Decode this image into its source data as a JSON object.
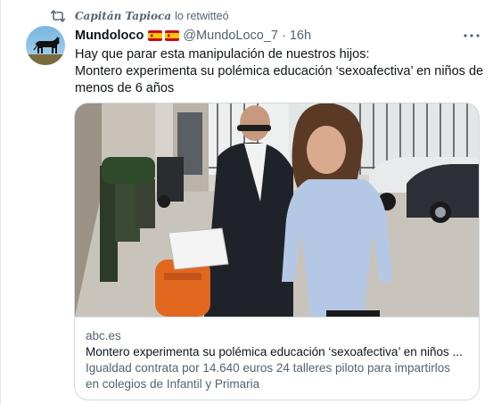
{
  "retweet": {
    "icon": "retweet-icon",
    "user": "Capitán Tapioca",
    "label": "lo retwitteó"
  },
  "author": {
    "avatar_icon": "bull-silhouette-avatar",
    "name": "Mundoloco",
    "flags": [
      "spain-flag-icon",
      "spain-flag-icon"
    ],
    "handle": "@MundoLoco_7",
    "separator": "·",
    "time": "16h"
  },
  "more_icon": "more-options-icon",
  "tweet": {
    "lines": [
      "Hay que parar esta manipulación de nuestros hijos:",
      "Montero experimenta su polémica educación ‘sexoafectiva’ en niños de",
      "menos de 6 años"
    ]
  },
  "card": {
    "domain": "abc.es",
    "title": "Montero experimenta su polémica educación ‘sexoafectiva’ en niños ...",
    "description_lines": [
      "Igualdad contrata por 14.640 euros 24 talleres piloto para impartirlos",
      "en colegios de Infantil y Primaria"
    ]
  },
  "colors": {
    "text_primary": "#0f1419",
    "text_secondary": "#536471",
    "border": "#cfd9de",
    "flag_red": "#c60b1e",
    "flag_yellow": "#ffc400"
  }
}
